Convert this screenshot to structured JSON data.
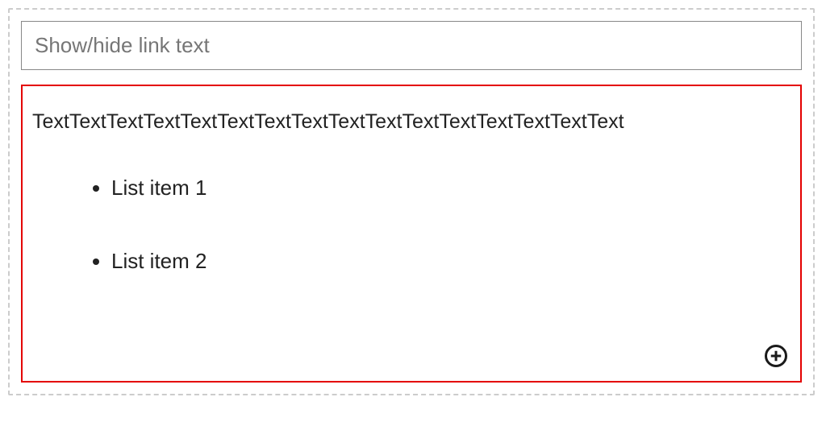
{
  "input": {
    "placeholder": "Show/hide link text",
    "value": ""
  },
  "content": {
    "paragraph": "TextTextTextTextTextTextTextTextTextTextTextTextTextTextTextText",
    "list_items": [
      "List item 1",
      "List item 2"
    ]
  },
  "icons": {
    "add": "plus-circle-icon"
  }
}
